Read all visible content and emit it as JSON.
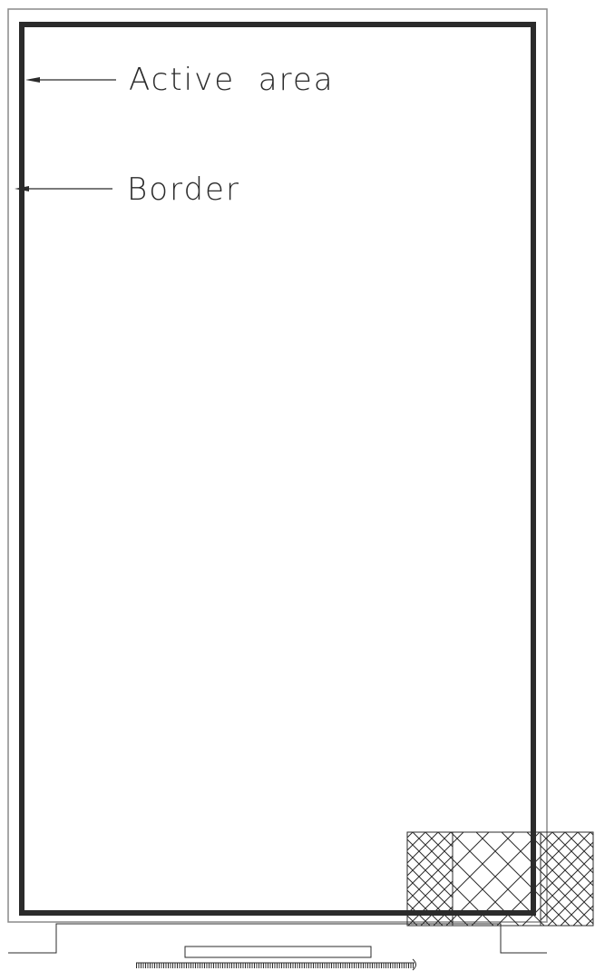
{
  "callouts": {
    "active_area": "Active  area",
    "border": "Border"
  },
  "colors": {
    "line": "#2b2b2b",
    "thin_line": "#8a8a8a",
    "background": "#ffffff"
  }
}
